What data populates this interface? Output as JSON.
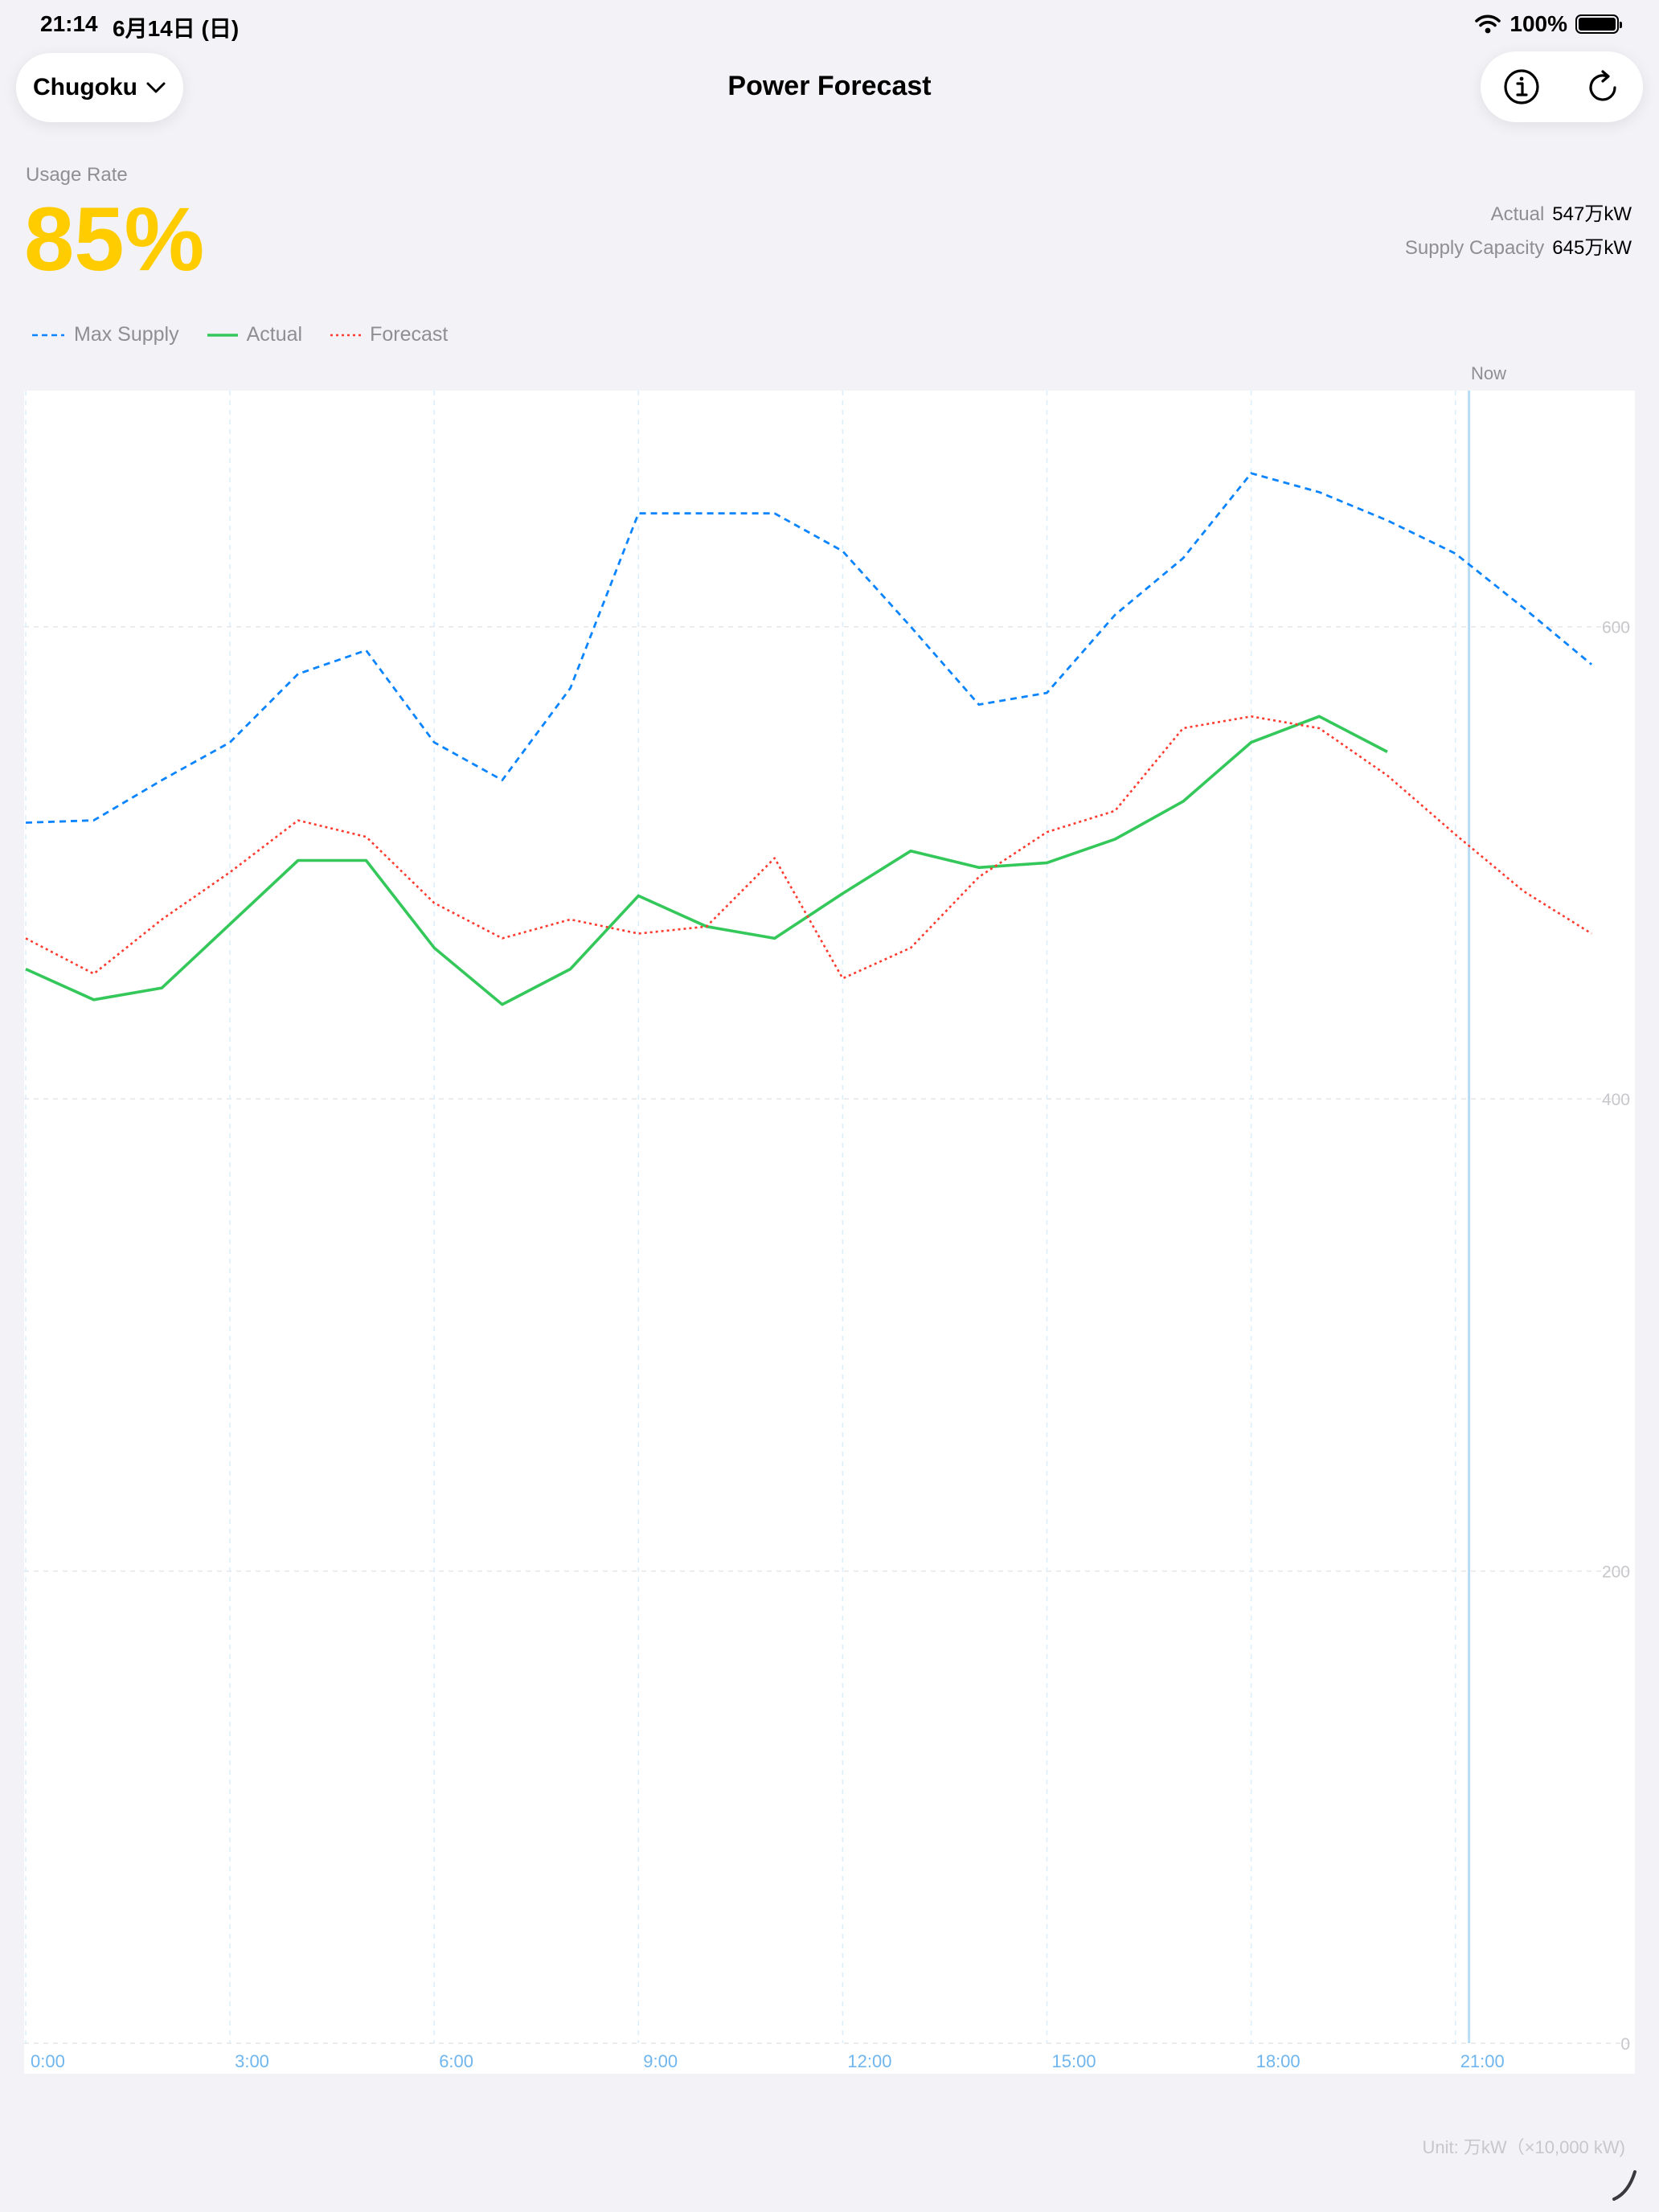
{
  "status_bar": {
    "time": "21:14",
    "date": "6月14日 (日)",
    "battery_percent": "100%",
    "icons": [
      "wifi-icon",
      "battery-icon"
    ]
  },
  "nav": {
    "region": "Chugoku",
    "title": "Power Forecast",
    "icons": [
      "chevron-down-icon",
      "info-icon",
      "refresh-icon"
    ]
  },
  "usage": {
    "label": "Usage Rate",
    "value": "85%",
    "color": "#ffcc00"
  },
  "stats": {
    "actual_label": "Actual",
    "actual_value": "547万kW",
    "capacity_label": "Supply Capacity",
    "capacity_value": "645万kW"
  },
  "legend": {
    "max_supply": "Max Supply",
    "actual": "Actual",
    "forecast": "Forecast"
  },
  "now_label": "Now",
  "unit_note": "Unit: 万kW（×10,000 kW)",
  "chart_data": {
    "type": "line",
    "x": [
      0,
      1,
      2,
      3,
      4,
      5,
      6,
      7,
      8,
      9,
      10,
      11,
      12,
      13,
      14,
      15,
      16,
      17,
      18,
      19,
      20,
      21,
      22,
      23
    ],
    "x_tick_labels": [
      "0:00",
      "3:00",
      "6:00",
      "9:00",
      "12:00",
      "15:00",
      "18:00",
      "21:00"
    ],
    "y_tick_labels": [
      "0",
      "200",
      "400",
      "600"
    ],
    "ylim": [
      0,
      700
    ],
    "xlim": [
      0,
      23
    ],
    "now_x": 21.2,
    "grid": true,
    "legend_position": "top-left",
    "series": [
      {
        "name": "Max Supply",
        "color": "#0a84ff",
        "style": "dashed",
        "values": [
          517,
          518,
          535,
          551,
          580,
          590,
          551,
          535,
          574,
          648,
          648,
          648,
          632,
          600,
          567,
          572,
          605,
          629,
          665,
          657,
          645,
          631,
          608,
          584
        ]
      },
      {
        "name": "Actual",
        "color": "#34c759",
        "style": "solid",
        "values": [
          455,
          442,
          447,
          474,
          501,
          501,
          464,
          440,
          455,
          486,
          473,
          468,
          487,
          505,
          498,
          500,
          510,
          526,
          551,
          562,
          547,
          null,
          null,
          null
        ]
      },
      {
        "name": "Forecast",
        "color": "#ff3b30",
        "style": "dotted",
        "values": [
          468,
          453,
          476,
          496,
          518,
          511,
          483,
          468,
          476,
          470,
          473,
          502,
          451,
          464,
          494,
          513,
          522,
          557,
          562,
          557,
          537,
          512,
          488,
          470
        ]
      }
    ]
  }
}
